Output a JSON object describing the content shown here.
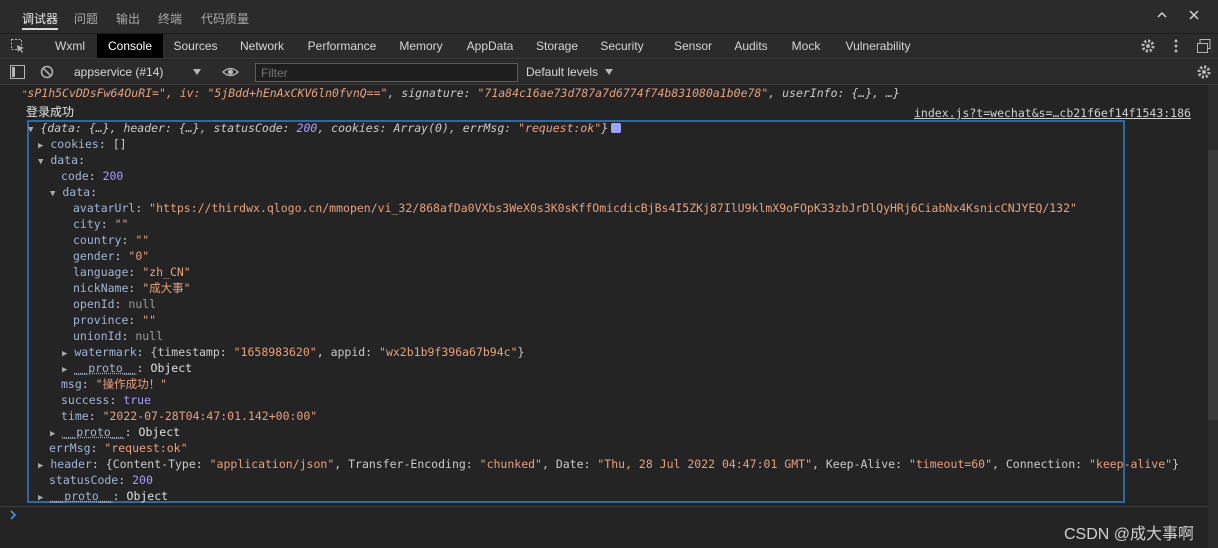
{
  "panel_tabs": [
    "调试器",
    "问题",
    "输出",
    "终端",
    "代码质量"
  ],
  "tool_tabs": [
    "Wxml",
    "Console",
    "Sources",
    "Network",
    "Performance",
    "Memory",
    "AppData",
    "Storage",
    "Security",
    "Sensor",
    "Audits",
    "Mock",
    "Vulnerability"
  ],
  "toolbar": {
    "context": "appservice (#14)",
    "filter_placeholder": "Filter",
    "levels": "Default levels"
  },
  "console": {
    "truncated_line": {
      "prefix": "sP1h5CvDDsFw64OuRI=\", iv: ",
      "iv": "\"5jBdd+hEnAxCKV6ln0fvnQ==\"",
      "mid": ", signature: ",
      "signature": "\"71a84c16ae73d787a7d6774f74b831080a1b0e78\"",
      "suffix": ", userInfo: {…}, …}"
    },
    "log_message": "登录成功",
    "source_link": "index.js?t=wechat&s=…cb21f6ef14f1543:186",
    "summary": {
      "pre": "{data: {…}, header: {…}, statusCode: ",
      "status": "200",
      "mid": ", cookies: Array(0), errMsg: ",
      "errmsg": "\"request:ok\"",
      "post": "}"
    },
    "cookies": {
      "key": "cookies",
      "val": "[]"
    },
    "data_key": "data",
    "code": {
      "key": "code",
      "val": "200"
    },
    "inner_data_key": "data",
    "fields": {
      "avatarUrl": "\"https://thirdwx.qlogo.cn/mmopen/vi_32/868afDa0VXbs3WeX0s3K0sKffOmicdicBjBs4I5ZKj87IlU9klmX9oFOpK33zbJrDlQyHRj6CiabNx4KsnicCNJYEQ/132\"",
      "city": "\"\"",
      "country": "\"\"",
      "gender": "\"0\"",
      "language": "\"zh_CN\"",
      "nickName": "\"成大事\"",
      "openId": "null",
      "province": "\"\"",
      "unionId": "null"
    },
    "watermark": {
      "key": "watermark",
      "pre": "{timestamp: ",
      "timestamp": "\"1658983620\"",
      "mid": ", appid: ",
      "appid": "\"wx2b1b9f396a67b94c\"",
      "post": "}"
    },
    "proto_key": "__proto__",
    "proto_val": "Object",
    "msg": {
      "key": "msg",
      "val": "\"操作成功！\""
    },
    "success": {
      "key": "success",
      "val": "true"
    },
    "time": {
      "key": "time",
      "val": "\"2022-07-28T04:47:01.142+00:00\""
    },
    "errMsg": {
      "key": "errMsg",
      "val": "\"request:ok\""
    },
    "header": {
      "key": "header",
      "p1": "{Content-Type: ",
      "v1": "\"application/json\"",
      "p2": ", Transfer-Encoding: ",
      "v2": "\"chunked\"",
      "p3": ", Date: ",
      "v3": "\"Thu, 28 Jul 2022 04:47:01 GMT\"",
      "p4": ", Keep-Alive: ",
      "v4": "\"timeout=60\"",
      "p5": ", Connection: ",
      "v5": "\"keep-alive\"",
      "p6": "}"
    },
    "statusCode": {
      "key": "statusCode",
      "val": "200"
    }
  },
  "watermark_text": "CSDN @成大事啊"
}
